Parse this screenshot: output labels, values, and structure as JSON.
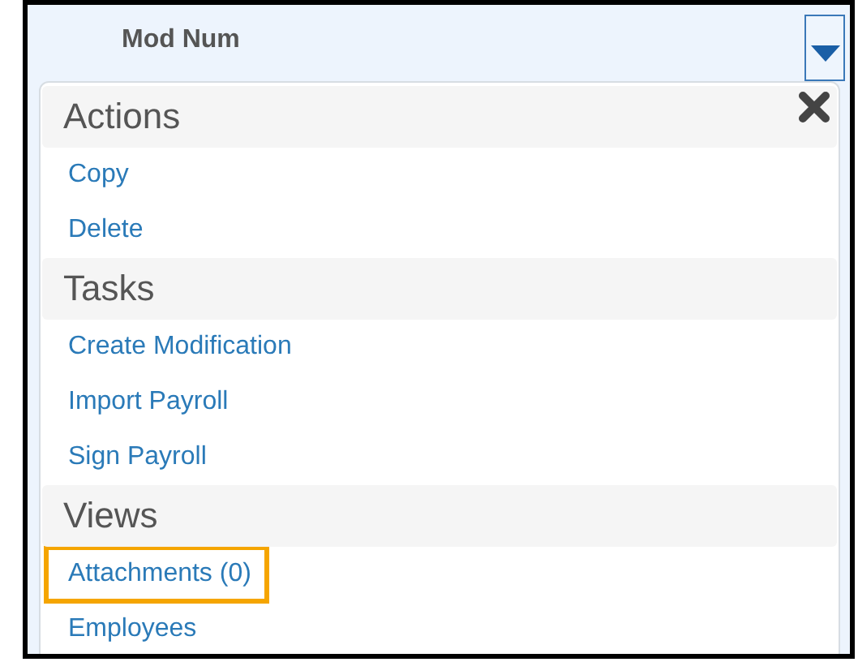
{
  "column_header": {
    "title": "Mod Num"
  },
  "menu": {
    "sections": [
      {
        "title": "Actions",
        "items": [
          {
            "label": "Copy",
            "highlighted": false
          },
          {
            "label": "Delete",
            "highlighted": false
          }
        ]
      },
      {
        "title": "Tasks",
        "items": [
          {
            "label": "Create Modification",
            "highlighted": false
          },
          {
            "label": "Import Payroll",
            "highlighted": false
          },
          {
            "label": "Sign Payroll",
            "highlighted": false
          }
        ]
      },
      {
        "title": "Views",
        "items": [
          {
            "label": "Attachments (0)",
            "highlighted": true
          },
          {
            "label": "Employees",
            "highlighted": false
          }
        ]
      }
    ]
  }
}
